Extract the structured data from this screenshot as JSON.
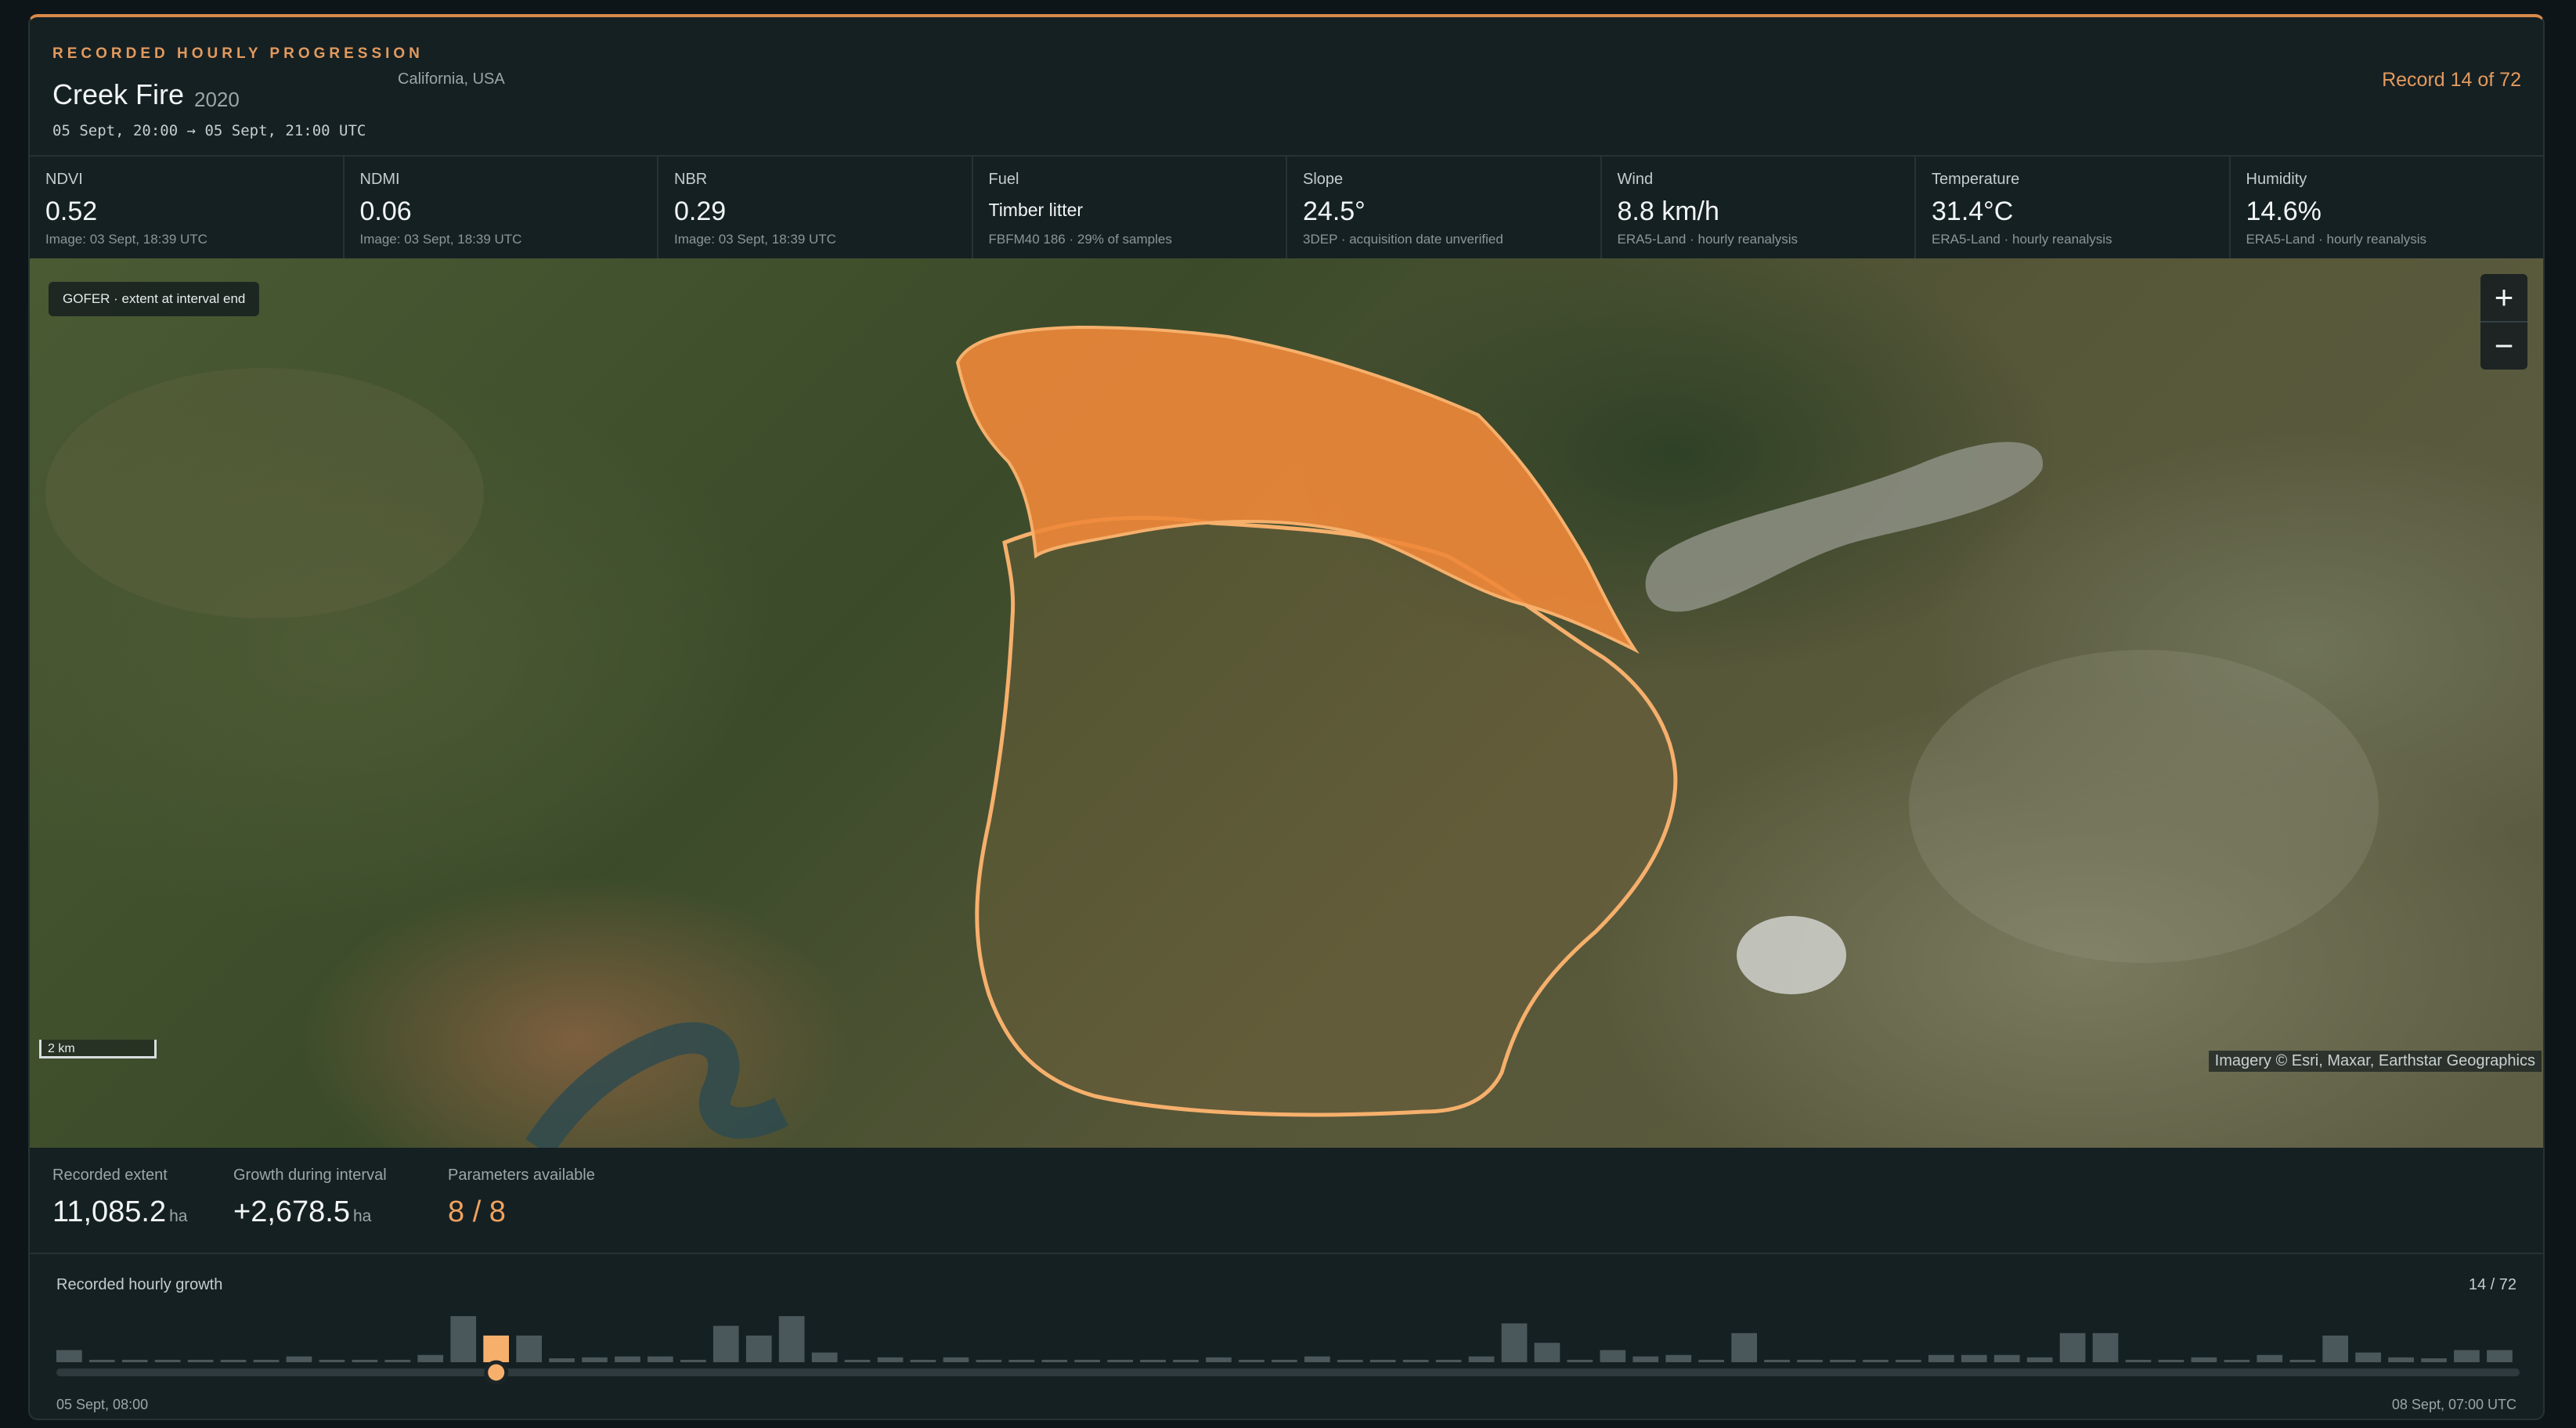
{
  "header": {
    "eyebrow": "RECORDED HOURLY PROGRESSION",
    "fire_name": "Creek Fire",
    "year": "2020",
    "location": "California, USA",
    "interval": "05 Sept, 20:00 → 05 Sept, 21:00 UTC",
    "record": "Record 14 of 72"
  },
  "metrics": [
    {
      "label": "NDVI",
      "value": "0.52",
      "sub": "Image: 03 Sept, 18:39 UTC"
    },
    {
      "label": "NDMI",
      "value": "0.06",
      "sub": "Image: 03 Sept, 18:39 UTC"
    },
    {
      "label": "NBR",
      "value": "0.29",
      "sub": "Image: 03 Sept, 18:39 UTC"
    },
    {
      "label": "Fuel",
      "value": "Timber litter",
      "sub": "FBFM40 186 · 29% of samples"
    },
    {
      "label": "Slope",
      "value": "24.5°",
      "sub": "3DEP · acquisition date unverified"
    },
    {
      "label": "Wind",
      "value": "8.8 km/h",
      "sub": "ERA5-Land · hourly reanalysis"
    },
    {
      "label": "Temperature",
      "value": "31.4°C",
      "sub": "ERA5-Land · hourly reanalysis"
    },
    {
      "label": "Humidity",
      "value": "14.6%",
      "sub": "ERA5-Land · hourly reanalysis"
    }
  ],
  "map": {
    "chip": "GOFER · extent at interval end",
    "zoom_in": "+",
    "zoom_out": "−",
    "scale": "2 km",
    "attribution": "Imagery © Esri, Maxar, Earthstar Geographics",
    "colors": {
      "growth": "#f0883a",
      "perimeter": "#f6b06c"
    }
  },
  "summary": {
    "extent_label": "Recorded extent",
    "extent_value": "11,085.2",
    "extent_unit": "ha",
    "growth_label": "Growth during interval",
    "growth_value": "+2,678.5",
    "growth_unit": "ha",
    "params_label": "Parameters available",
    "params_value": "8 / 8"
  },
  "timeline": {
    "title": "Recorded hourly growth",
    "count": "14 / 72",
    "start": "05 Sept, 08:00",
    "end": "08 Sept, 07:00 UTC",
    "selected_index": 13,
    "colors": {
      "bar": "#4a575b",
      "selected": "#f6b06c"
    },
    "bars": [
      0.25,
      0.05,
      0.05,
      0.05,
      0.05,
      0.05,
      0.05,
      0.12,
      0.05,
      0.05,
      0.05,
      0.15,
      0.95,
      0.55,
      0.55,
      0.08,
      0.1,
      0.12,
      0.12,
      0.05,
      0.75,
      0.55,
      0.95,
      0.2,
      0.05,
      0.1,
      0.05,
      0.1,
      0.05,
      0.05,
      0.05,
      0.05,
      0.05,
      0.05,
      0.05,
      0.1,
      0.05,
      0.05,
      0.12,
      0.05,
      0.05,
      0.05,
      0.05,
      0.12,
      0.8,
      0.4,
      0.05,
      0.25,
      0.12,
      0.15,
      0.05,
      0.6,
      0.05,
      0.05,
      0.05,
      0.05,
      0.05,
      0.15,
      0.15,
      0.15,
      0.1,
      0.6,
      0.6,
      0.05,
      0.05,
      0.1,
      0.05,
      0.15,
      0.05,
      0.55,
      0.2,
      0.1,
      0.08,
      0.25,
      0.25
    ]
  }
}
